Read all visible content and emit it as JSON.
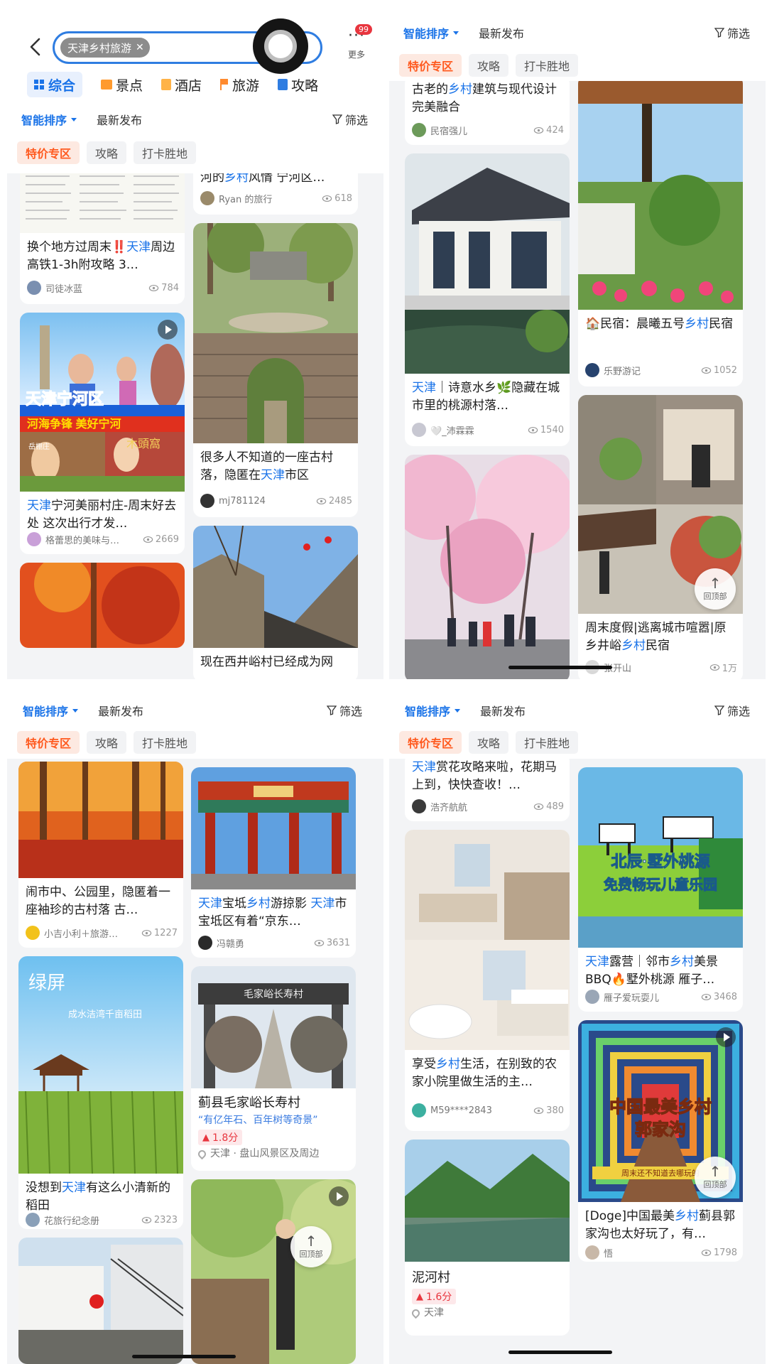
{
  "search": {
    "back_icon": "back-arrow-icon",
    "query_chip": "天津乡村旅游",
    "clear_icon": "close-icon",
    "more_label": "更多",
    "more_badge": "99"
  },
  "category_tabs": [
    {
      "label": "综合",
      "icon": "grid-icon",
      "active": true
    },
    {
      "label": "景点",
      "icon": "ticket-icon",
      "active": false
    },
    {
      "label": "酒店",
      "icon": "hotel-icon",
      "active": false
    },
    {
      "label": "旅游",
      "icon": "flag-icon",
      "active": false
    },
    {
      "label": "攻略",
      "icon": "book-icon",
      "active": false
    }
  ],
  "sort": {
    "smart": "智能排序",
    "newest": "最新发布",
    "filter": "筛选"
  },
  "chips": [
    "特价专区",
    "攻略",
    "打卡胜地"
  ],
  "to_top_label": "回顶部",
  "colors": {
    "accent": "#1a73e8",
    "hot": "#ff5a1f",
    "badge": "#e8353e"
  },
  "panels": [
    {
      "left": [
        {
          "title_parts": [
            [
              "换个地方过周末‼️",
              false
            ],
            [
              "天津",
              true
            ],
            [
              "周边高铁1-3h附攻略 3…",
              false
            ]
          ],
          "author": "司徒冰蓝",
          "views": "784"
        },
        {
          "title_parts": [
            [
              "天津",
              true
            ],
            [
              "宁河美丽村庄-周末好去处 这次出行才发…",
              false
            ]
          ],
          "author": "格蕾思的美味与…",
          "views": "2669",
          "video": true,
          "overlay": [
            "天津宁河区",
            "河海争锋 美好宁河",
            "岳棚庄",
            "木頭窩"
          ]
        },
        {
          "image_only": true
        }
      ],
      "right": [
        {
          "title_parts": [
            [
              "河的",
              false
            ],
            [
              "乡村",
              true
            ],
            [
              "风情 宁河区…",
              false
            ]
          ],
          "author": "Ryan 的旅行",
          "views": "618"
        },
        {
          "title_parts": [
            [
              "很多人不知道的一座古村落，隐匿在",
              false
            ],
            [
              "天津",
              true
            ],
            [
              "市区",
              false
            ]
          ],
          "author": "mj781124",
          "views": "2485"
        },
        {
          "title_parts": [
            [
              "现在西井峪村已经成为网",
              false
            ]
          ],
          "author": "",
          "views": ""
        }
      ]
    },
    {
      "left": [
        {
          "title_parts": [
            [
              "古老的",
              false
            ],
            [
              "乡村",
              true
            ],
            [
              "建筑与现代设计完美融合",
              false
            ]
          ],
          "author": "民宿强儿",
          "views": "424"
        },
        {
          "title_parts": [
            [
              "天津",
              true
            ],
            [
              "｜诗意水乡🌿隐藏在城市里的桃源村落…",
              false
            ]
          ],
          "author": "🤍_沛霖霖",
          "views": "1540"
        },
        {
          "image_only": true
        }
      ],
      "right": [
        {
          "title_parts": [
            [
              "🏠民宿：晨曦五号",
              false
            ],
            [
              "乡村",
              true
            ],
            [
              "民宿",
              false
            ]
          ],
          "author": "乐野游记",
          "views": "1052"
        },
        {
          "title_parts": [
            [
              "周末度假|逃离城市喧嚣|原乡井峪",
              false
            ],
            [
              "乡村",
              true
            ],
            [
              "民宿",
              false
            ]
          ],
          "author": "张开山",
          "views": "1万"
        }
      ]
    },
    {
      "left": [
        {
          "title_parts": [
            [
              "闹市中、公园里，隐匿着一座袖珍的古村落 古…",
              false
            ]
          ],
          "author": "小吉小利＋旅游…",
          "views": "1227"
        },
        {
          "title_parts": [
            [
              "没想到",
              false
            ],
            [
              "天津",
              true
            ],
            [
              "有这么小清新的稻田",
              false
            ]
          ],
          "author": "花旅行纪念册",
          "views": "2323",
          "overlay": [
            "绿屏",
            "成水洁湾千亩稻田"
          ]
        },
        {
          "image_only": true
        }
      ],
      "right": [
        {
          "title_parts": [
            [
              "天津",
              true
            ],
            [
              "宝坻",
              false
            ],
            [
              "乡村",
              true
            ],
            [
              "游掠影 ",
              false
            ],
            [
              "天津",
              true
            ],
            [
              "市宝坻区有着“京东…",
              false
            ]
          ],
          "author": "冯赣勇",
          "views": "3631"
        },
        {
          "poi": true,
          "name": "蓟县毛家峪长寿村",
          "tagline": "“有亿年石、百年树等奇景”",
          "score": "1.8分",
          "location": "天津 · 盘山风景区及周边",
          "overlay": [
            "毛家峪长寿村"
          ]
        },
        {
          "image_only": true,
          "video": true
        }
      ]
    },
    {
      "left": [
        {
          "title_parts": [
            [
              "天津",
              true
            ],
            [
              "赏花攻略来啦，花期马上到，快快查收！…",
              false
            ]
          ],
          "author": "浩齐航航",
          "views": "489"
        },
        {
          "title_parts": [
            [
              "享受",
              false
            ],
            [
              "乡村",
              true
            ],
            [
              "生活，在别致的农家小院里做生活的主…",
              false
            ]
          ],
          "author": "M59****2843",
          "views": "380"
        },
        {
          "poi": true,
          "name": "泥河村",
          "score": "1.6分",
          "location": "天津"
        }
      ],
      "right": [
        {
          "title_parts": [
            [
              "天津",
              true
            ],
            [
              "露营｜邻市",
              false
            ],
            [
              "乡村",
              true
            ],
            [
              "美景BBQ🔥墅外桃源 雁子…",
              false
            ]
          ],
          "author": "雁子爱玩耍儿",
          "views": "3468",
          "overlay": [
            "北辰·墅外桃源",
            "免费畅玩儿童乐园"
          ]
        },
        {
          "title_parts": [
            [
              "[Doge]中国最美",
              false
            ],
            [
              "乡村",
              true
            ],
            [
              "蓟县郭家沟也太好玩了，有…",
              false
            ]
          ],
          "author": "悟",
          "views": "1798",
          "video": true,
          "overlay": [
            "中国最美乡村",
            "郭家沟",
            "周末还不知道去哪玩的"
          ]
        }
      ]
    }
  ]
}
